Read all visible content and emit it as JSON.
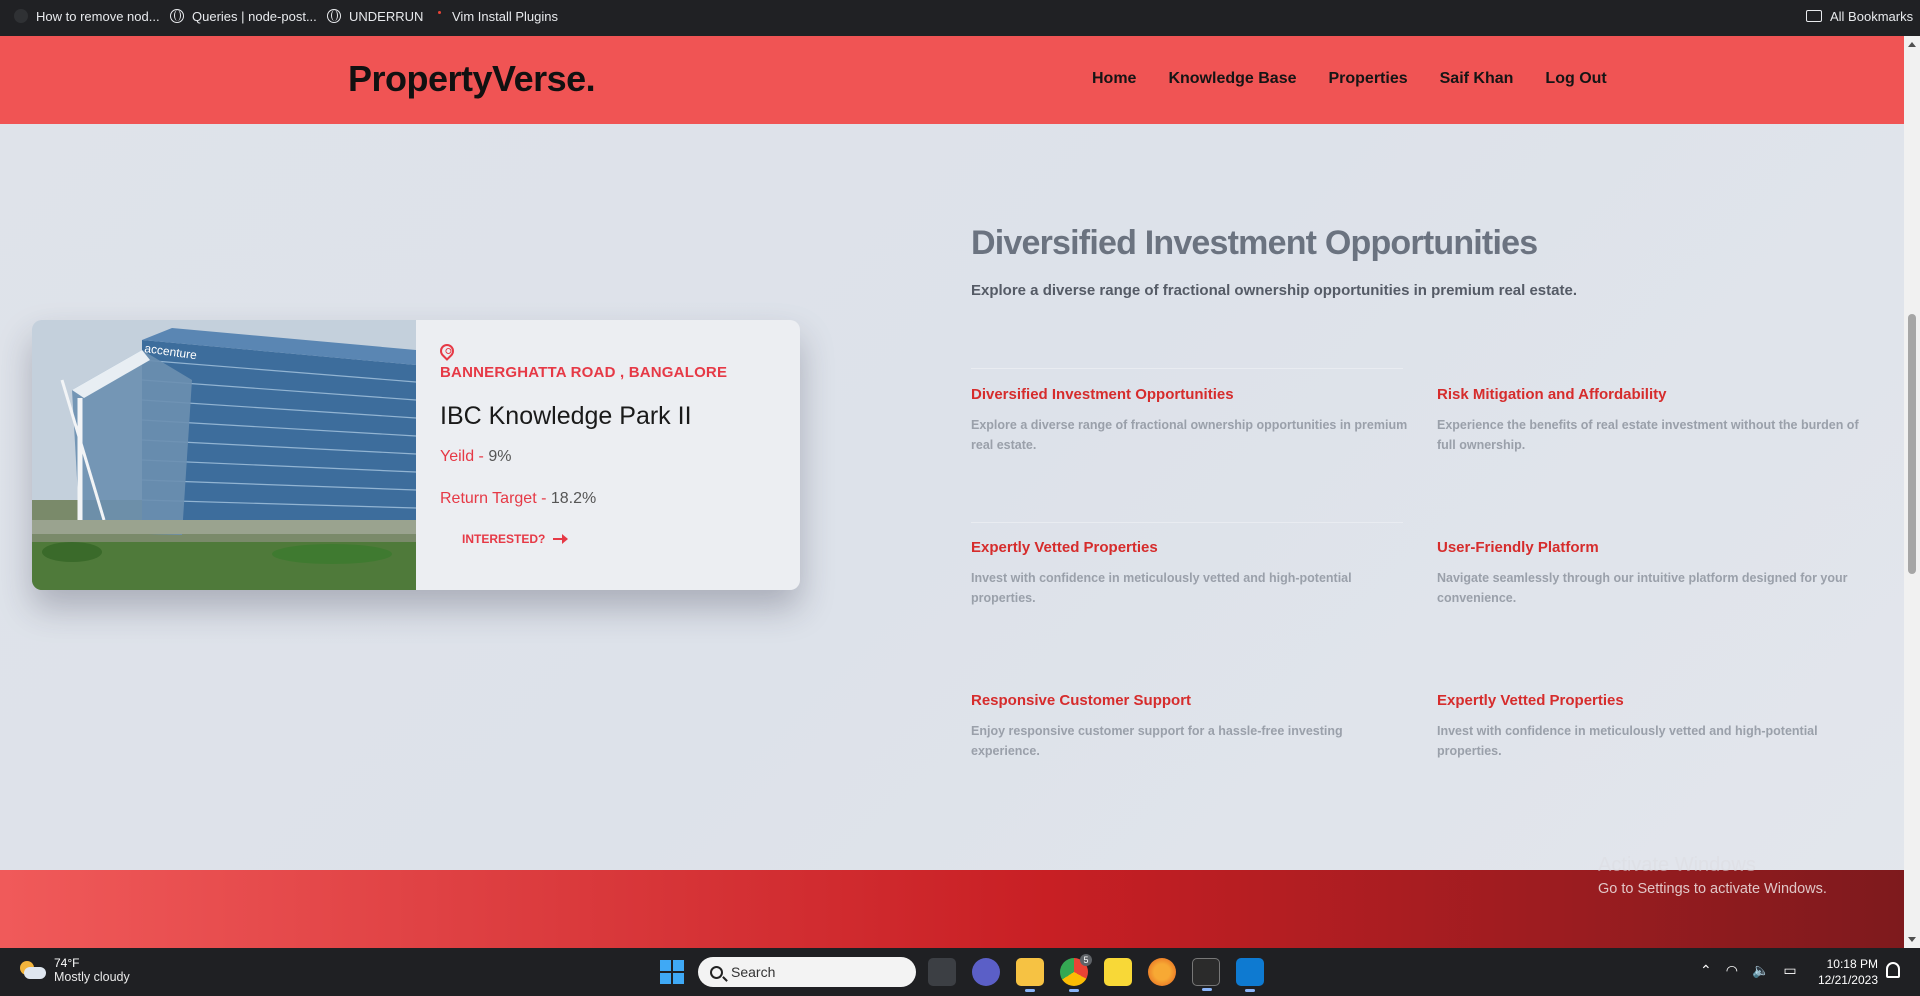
{
  "bookmarks": [
    {
      "label": "How to remove nod...",
      "icon": "app-icon"
    },
    {
      "label": "Queries | node-post...",
      "icon": "globe-icon"
    },
    {
      "label": "UNDERRUN",
      "icon": "globe-icon"
    },
    {
      "label": "Vim Install Plugins",
      "icon": "vim-icon"
    }
  ],
  "all_bookmarks_label": "All Bookmarks",
  "brand": {
    "logo": "PropertyVerse.",
    "accent": "#f05454",
    "red": "#e63946"
  },
  "nav": {
    "items": [
      "Home",
      "Knowledge Base",
      "Properties",
      "Saif Khan",
      "Log Out"
    ]
  },
  "property": {
    "location": "BANNERGHATTA ROAD , BANGALORE",
    "name": "IBC Knowledge Park II",
    "yield_label": "Yeild - ",
    "yield_value": "9%",
    "return_label": "Return Target - ",
    "return_value": "18.2%",
    "cta": "INTERESTED?",
    "image_text": "accenture"
  },
  "section": {
    "title": "Diversified Investment Opportunities",
    "subtitle": "Explore a diverse range of fractional ownership opportunities in premium real estate."
  },
  "features": [
    {
      "title": "Diversified Investment Opportunities",
      "desc": "Explore a diverse range of fractional ownership opportunities in premium real estate."
    },
    {
      "title": "Risk Mitigation and Affordability",
      "desc": "Experience the benefits of real estate investment without the burden of full ownership."
    },
    {
      "title": "Expertly Vetted Properties",
      "desc": "Invest with confidence in meticulously vetted and high-potential properties."
    },
    {
      "title": "User-Friendly Platform",
      "desc": "Navigate seamlessly through our intuitive platform designed for your convenience."
    },
    {
      "title": "Responsive Customer Support",
      "desc": "Enjoy responsive customer support for a hassle-free investing experience."
    },
    {
      "title": "Expertly Vetted Properties",
      "desc": "Invest with confidence in meticulously vetted and high-potential properties."
    }
  ],
  "watermark": {
    "line1": "Activate Windows",
    "line2": "Go to Settings to activate Windows."
  },
  "taskbar": {
    "weather_temp": "74°F",
    "weather_desc": "Mostly cloudy",
    "search_placeholder": "Search",
    "time": "10:18 PM",
    "date": "12/21/2023",
    "apps": [
      "task-view-icon",
      "chat-icon",
      "file-explorer-icon",
      "chrome-icon",
      "sticky-notes-icon",
      "fl-studio-icon",
      "terminal-icon",
      "vscode-icon"
    ],
    "chrome_badge": "5"
  }
}
